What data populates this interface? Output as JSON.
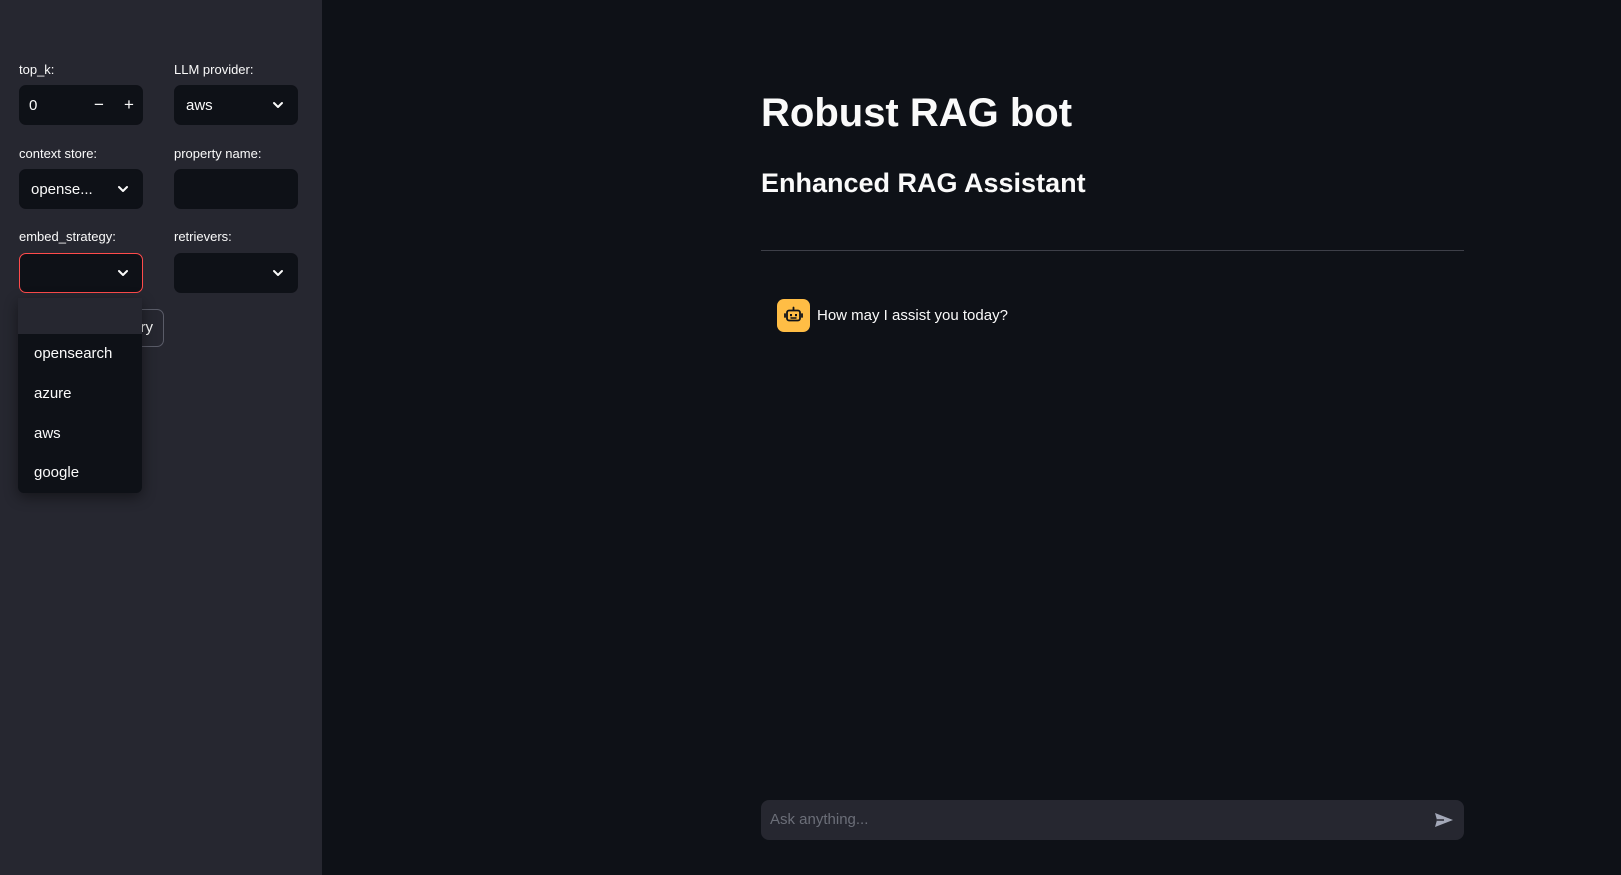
{
  "sidebar": {
    "top_k": {
      "label": "top_k:",
      "value": "0",
      "minus": "−",
      "plus": "+"
    },
    "llm_provider": {
      "label": "LLM provider:",
      "value": "aws"
    },
    "context_store": {
      "label": "context store:",
      "value": "opense..."
    },
    "property_name": {
      "label": "property name:",
      "value": ""
    },
    "embed_strategy": {
      "label": "embed_strategy:",
      "value": "",
      "state": "open-invalid"
    },
    "retrievers": {
      "label": "retrievers:",
      "value": ""
    },
    "obscured_button": {
      "visible_text": "ry"
    },
    "dropdown_options": [
      "opensearch",
      "azure",
      "aws",
      "google"
    ]
  },
  "main": {
    "title": "Robust RAG bot",
    "subtitle": "Enhanced RAG Assistant",
    "messages": [
      {
        "role": "assistant",
        "avatar_icon": "robot-icon",
        "text": "How may I assist you today?"
      }
    ],
    "chat_input": {
      "placeholder": "Ask anything..."
    }
  },
  "colors": {
    "sidebar_bg": "#262730",
    "main_bg": "#0e1117",
    "invalid_border": "#ff4b4b",
    "avatar_bg": "#ffbd45"
  }
}
